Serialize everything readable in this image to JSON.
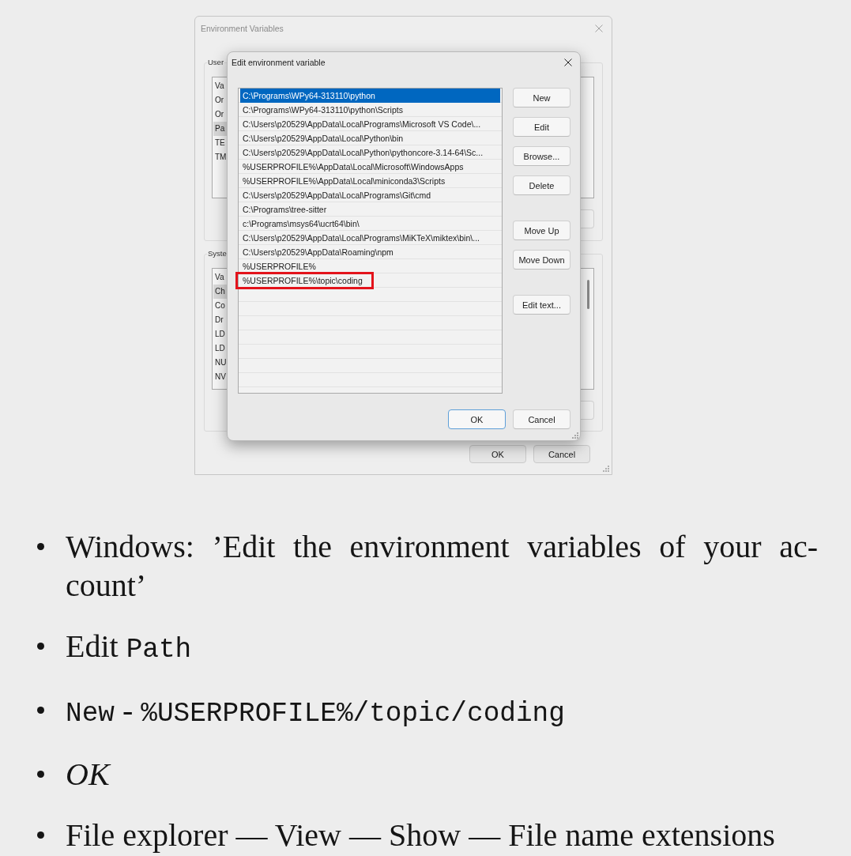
{
  "figure": {
    "main_window": {
      "title": "Environment Variables",
      "user_section": {
        "label": "User",
        "list_header": "Va",
        "items": [
          {
            "text": "Or",
            "selected": false
          },
          {
            "text": "Or",
            "selected": false
          },
          {
            "text": "Pa",
            "selected": true
          },
          {
            "text": "TE",
            "selected": false
          },
          {
            "text": "TM",
            "selected": false
          }
        ]
      },
      "system_section": {
        "label": "Syste",
        "list_header": "Va",
        "items": [
          {
            "text": "Ch",
            "selected": true
          },
          {
            "text": "Co",
            "selected": false
          },
          {
            "text": "Dr",
            "selected": false
          },
          {
            "text": "LD",
            "selected": false
          },
          {
            "text": "LD",
            "selected": false
          },
          {
            "text": "NU",
            "selected": false
          },
          {
            "text": "NV",
            "selected": false
          }
        ]
      },
      "buttons": [
        "OK",
        "Cancel"
      ]
    },
    "dialog": {
      "title": "Edit environment variable",
      "entries": [
        {
          "text": "C:\\Programs\\WPy64-313110\\python",
          "selected": true,
          "annotated": false
        },
        {
          "text": "C:\\Programs\\WPy64-313110\\python\\Scripts",
          "selected": false,
          "annotated": false
        },
        {
          "text": "C:\\Users\\p20529\\AppData\\Local\\Programs\\Microsoft VS Code\\...",
          "selected": false,
          "annotated": false
        },
        {
          "text": "C:\\Users\\p20529\\AppData\\Local\\Python\\bin",
          "selected": false,
          "annotated": false
        },
        {
          "text": "C:\\Users\\p20529\\AppData\\Local\\Python\\pythoncore-3.14-64\\Sc...",
          "selected": false,
          "annotated": false
        },
        {
          "text": "%USERPROFILE%\\AppData\\Local\\Microsoft\\WindowsApps",
          "selected": false,
          "annotated": false
        },
        {
          "text": "%USERPROFILE%\\AppData\\Local\\miniconda3\\Scripts",
          "selected": false,
          "annotated": false
        },
        {
          "text": "C:\\Users\\p20529\\AppData\\Local\\Programs\\Git\\cmd",
          "selected": false,
          "annotated": false
        },
        {
          "text": "C:\\Programs\\tree-sitter",
          "selected": false,
          "annotated": false
        },
        {
          "text": "c:\\Programs\\msys64\\ucrt64\\bin\\",
          "selected": false,
          "annotated": false
        },
        {
          "text": "C:\\Users\\p20529\\AppData\\Local\\Programs\\MiKTeX\\miktex\\bin\\...",
          "selected": false,
          "annotated": false
        },
        {
          "text": "C:\\Users\\p20529\\AppData\\Roaming\\npm",
          "selected": false,
          "annotated": false
        },
        {
          "text": "%USERPROFILE%",
          "selected": false,
          "annotated": false
        },
        {
          "text": "%USERPROFILE%\\topic\\coding",
          "selected": false,
          "annotated": true
        }
      ],
      "side_button_groups": [
        [
          "New",
          "Edit",
          "Browse...",
          "Delete"
        ],
        [
          "Move Up",
          "Move Down"
        ],
        [
          "Edit text..."
        ]
      ],
      "footer_buttons": [
        {
          "label": "OK",
          "default": true
        },
        {
          "label": "Cancel",
          "default": false
        }
      ]
    }
  },
  "bullets": [
    {
      "parts": [
        {
          "kind": "plain",
          "text": "Windows: ’Edit the environment variables of your ac-count’"
        }
      ]
    },
    {
      "parts": [
        {
          "kind": "plain",
          "text": "Edit "
        },
        {
          "kind": "code",
          "text": "Path"
        }
      ]
    },
    {
      "parts": [
        {
          "kind": "code",
          "text": "New"
        },
        {
          "kind": "plain",
          "text": " - "
        },
        {
          "kind": "code",
          "text": "%USERPROFILE%/topic/coding"
        }
      ]
    },
    {
      "parts": [
        {
          "kind": "italic",
          "text": "OK"
        }
      ]
    },
    {
      "parts": [
        {
          "kind": "plain",
          "text": "File explorer — View — Show — File name extensions"
        }
      ]
    }
  ]
}
